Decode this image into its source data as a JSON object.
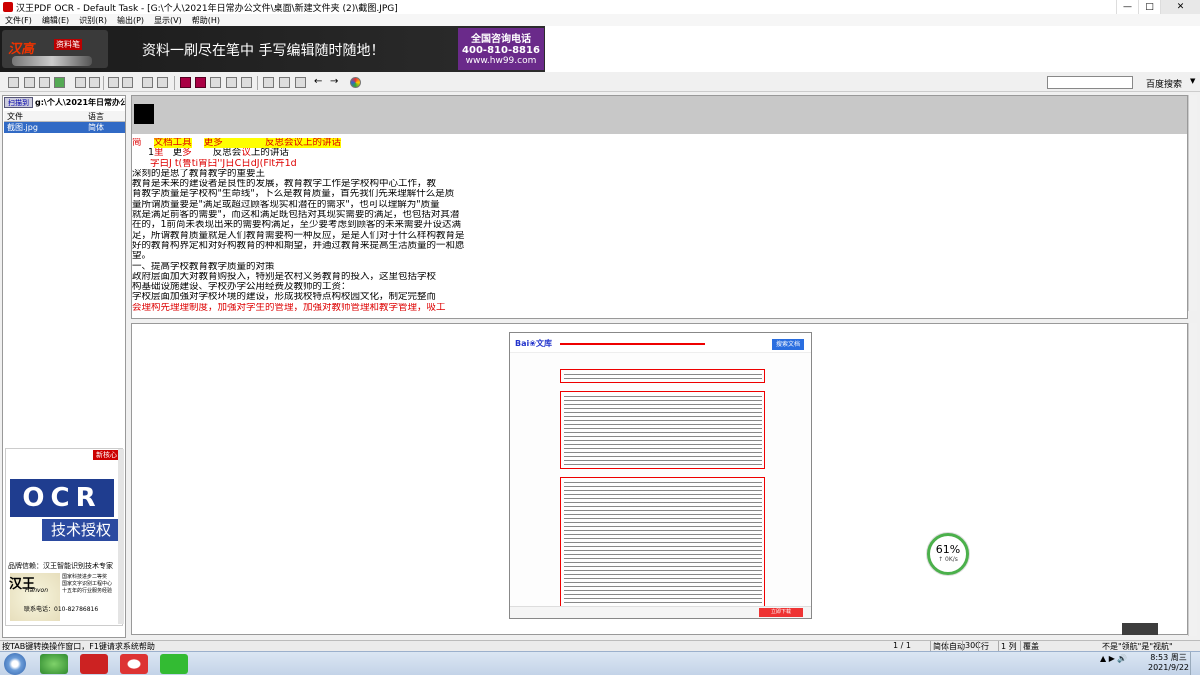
{
  "window": {
    "title": "汉王PDF OCR - Default Task - [G:\\个人\\2021年日常办公文件\\桌面\\新建文件夹 (2)\\截图.JPG]",
    "minimize": "—",
    "maximize": "□",
    "close": "✕"
  },
  "menu": [
    "文件(F)",
    "编辑(E)",
    "识别(R)",
    "输出(P)",
    "显示(V)",
    "帮助(H)"
  ],
  "banner": {
    "logo": "汉高",
    "logo_sub": "资料笔",
    "slogan": "资料一刷尽在笔中    手写编辑随时随地！",
    "hotline_title": "全国咨询电话",
    "hotline_number": "400-810-8816",
    "hotline_url": "www.hw99.com"
  },
  "toolbar": {
    "search_label": "百度搜索",
    "back": "←",
    "forward": "→"
  },
  "left_panel": {
    "tab": "扫描到",
    "path": "g:\\个人\\2021年日常办公",
    "col_file": "文件",
    "col_lang": "语言",
    "file_name": "截图.jpg",
    "file_lang": "简体",
    "ad": {
      "tag": "新核心",
      "ocr": "OCR",
      "auth": "技术授权",
      "brand": "品牌信赖：汉王智能识别技术专家",
      "hanwang": "汉王",
      "hanwang_en": "Hanvon",
      "notes": [
        "国家科技进步二等奖",
        "国家文字识别工程中心",
        "十五年的行业服务经验"
      ],
      "phone": "联系电话：010-82786816"
    }
  },
  "ocr_text": {
    "line0_a": "简",
    "line0_b": "文档工具",
    "line0_c": "更多",
    "line0_d": "反思会议上的讲话",
    "line1_a": "1",
    "line1_b": "里",
    "line1_c": "更",
    "line1_d": "多",
    "line1_e": "反思会",
    "line1_f": "议",
    "line1_g": "上的讲话",
    "line2": "字白J t(鲁ti胄臼''J日C日dJ(Flt卉1d",
    "lines": [
      "深刻的是思了教育教学的重要王",
      "  教育是未来的建设者是良性的发展，教育教学工作是学校构中心工作，教",
      "育教学质量是学校构\"生命线\"，卜么是教育质量，首先我们先来理解什么是质",
      "量所谓质量要是\"满足或超过顾客现实和潜在的需求\"，也可以理解为\"质量",
      "就是满足前客的需要\"，而这和满足既包括对其现实需要的满足，也包括对其潜",
      "在的，1前尚未表现出来的需要构满足，至少要考虑到顾客的未来需要开设达满",
      "足，所谓教育质量就是人们教育需要构一种反应，是是人们对于什么样构教育是",
      "好的教育构界定和对好构教育的种和期望，并通过教育来提高生活质量的一和愿",
      "望。",
      "一、提高学校教育教学质量的对策",
      "  政府层面加大对教育购投入，特别是农村义务教育的投入，这里包括学校",
      "构基础设施建设、学校办学公用经费及教师的工资：",
      "  学校层面加强对学校环境的建设，形成我校特点构校园文化，制定完整而",
      "会理构先理理制度，加强对学生的管理，加强对教师管理和教学管理，吸工"
    ]
  },
  "doc_image": {
    "baidu": "Bai❀文库",
    "btn": "搜索文档",
    "footer_btn": "立即下载"
  },
  "progress": {
    "percent": "61%",
    "speed": "↑ 0K/s"
  },
  "status": {
    "message": "按TAB键转换操作窗口，F1键请求系统帮助",
    "page": "1 / 1",
    "cells": [
      "简体",
      "自动",
      "30C",
      "行",
      "1 列",
      "覆盖"
    ],
    "right_msg": "不是\"领航\"是\"视航\""
  },
  "taskbar": {
    "time": "8:53 周三",
    "date": "2021/9/22"
  }
}
